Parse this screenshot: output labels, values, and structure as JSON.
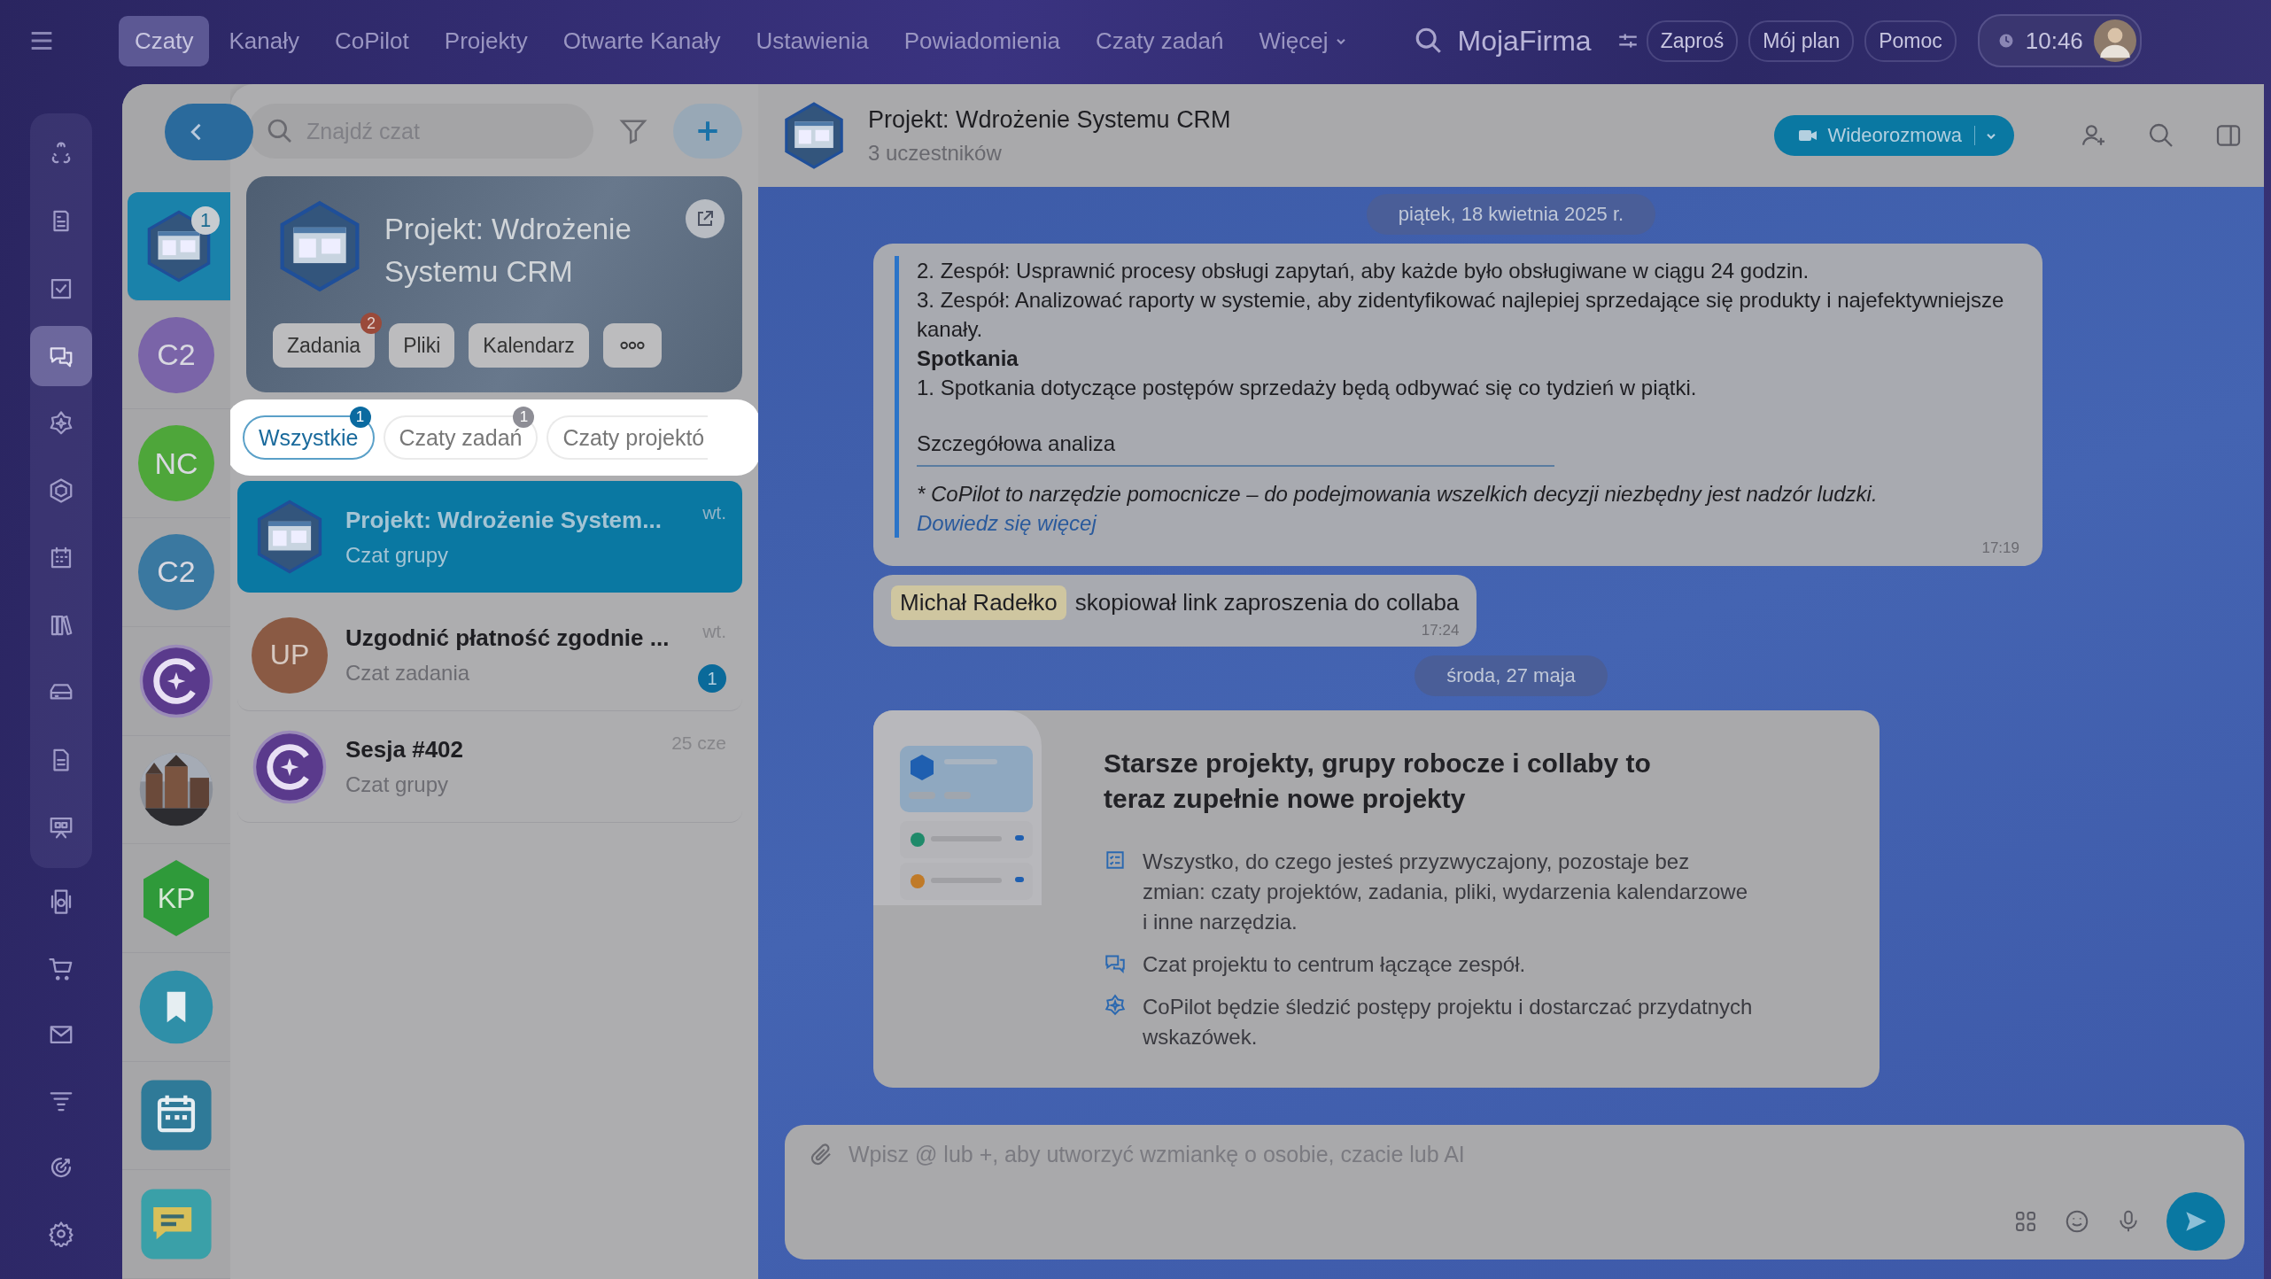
{
  "top_nav": {
    "items": [
      {
        "label": "Czaty",
        "selected": true,
        "kind": "link"
      },
      {
        "label": "Kanały",
        "selected": false,
        "kind": "link"
      },
      {
        "label": "CoPilot",
        "selected": false,
        "kind": "link"
      },
      {
        "label": "Projekty",
        "selected": false,
        "kind": "link"
      },
      {
        "label": "Otwarte Kanały",
        "selected": false,
        "kind": "link"
      },
      {
        "label": "Ustawienia",
        "selected": false,
        "kind": "link"
      },
      {
        "label": "Powiadomienia",
        "selected": false,
        "kind": "link"
      },
      {
        "label": "Czaty zadań",
        "selected": false,
        "kind": "link"
      },
      {
        "label": "Więcej",
        "selected": false,
        "kind": "dropdown"
      }
    ],
    "brand": "MojaFirma",
    "buttons": [
      "Zaproś",
      "Mój plan",
      "Pomoc"
    ],
    "time": "10:46"
  },
  "rail": {
    "group": [
      {
        "kind": "share",
        "selected": false
      },
      {
        "kind": "news",
        "selected": false
      },
      {
        "kind": "tasks",
        "selected": false
      },
      {
        "kind": "chat",
        "selected": true
      },
      {
        "kind": "sparkle",
        "selected": false
      },
      {
        "kind": "hexagon",
        "selected": false
      },
      {
        "kind": "calendar",
        "selected": false
      },
      {
        "kind": "books",
        "selected": false
      },
      {
        "kind": "drive",
        "selected": false
      },
      {
        "kind": "document",
        "selected": false
      },
      {
        "kind": "board",
        "selected": false
      }
    ],
    "items": [
      {
        "kind": "phone",
        "selected": false
      },
      {
        "kind": "cart",
        "selected": false
      },
      {
        "kind": "mail",
        "selected": false
      },
      {
        "kind": "funnel",
        "selected": false
      },
      {
        "kind": "target",
        "selected": false
      }
    ],
    "bottom": [
      {
        "kind": "settings",
        "selected": false
      }
    ]
  },
  "recent": [
    {
      "kind": "project",
      "selected": true,
      "badge": "1"
    },
    {
      "kind": "initials",
      "initials": "C2",
      "color": "#7a64a8",
      "selected": false
    },
    {
      "kind": "initials",
      "initials": "NC",
      "color": "#4ea63a",
      "selected": false
    },
    {
      "kind": "initials",
      "initials": "C2",
      "color": "#3a78a0",
      "selected": false
    },
    {
      "kind": "copilot",
      "selected": false
    },
    {
      "kind": "picture",
      "selected": false
    },
    {
      "kind": "hex",
      "initials": "KP",
      "color": "#2f9a3a",
      "selected": false
    },
    {
      "kind": "bookmark",
      "selected": false
    },
    {
      "kind": "calendar",
      "selected": false
    },
    {
      "kind": "chat",
      "selected": false
    }
  ],
  "chat_list": {
    "search": {
      "placeholder": "Znajdź czat"
    },
    "project_card": {
      "title": "Projekt: Wdrożenie Systemu CRM",
      "buttons": [
        {
          "label": "Zadania",
          "badge": "2"
        },
        {
          "label": "Pliki"
        },
        {
          "label": "Kalendarz"
        }
      ]
    },
    "tabs": [
      {
        "label": "Wszystkie",
        "selected": true,
        "badge": "1",
        "muted": false
      },
      {
        "label": "Czaty zadań",
        "selected": false,
        "badge": "1",
        "muted": true
      },
      {
        "label": "Czaty projektó",
        "selected": false
      }
    ],
    "chats": [
      {
        "kind": "project",
        "title": "Projekt: Wdrożenie System...",
        "subtitle": "Czat grupy",
        "time": "wt.",
        "selected": true
      },
      {
        "kind": "initials",
        "initials": "UP",
        "color": "#8a5a44",
        "title": "Uzgodnić płatność zgodnie ...",
        "subtitle": "Czat zadania",
        "time": "wt.",
        "unread": "1",
        "selected": false
      },
      {
        "kind": "copilot",
        "title": "Sesja #402",
        "subtitle": "Czat grupy",
        "time": "25 cze",
        "selected": false
      }
    ]
  },
  "chat": {
    "title": "Projekt: Wdrożenie Systemu CRM",
    "subtitle": "3 uczestników",
    "video_button": "Wideorozmowa",
    "messages": [
      {
        "kind": "copilot",
        "time": "17:19",
        "lines": [
          {
            "kind": "text",
            "text": "2. Zespół: Usprawnić procesy obsługi zapytań, aby każde było obsługiwane w ciągu 24 godzin."
          },
          {
            "kind": "text",
            "text": "3. Zespół: Analizować raporty w systemie, aby zidentyfikować najlepiej sprzedające się produkty i najefektywniejsze kanały."
          },
          {
            "kind": "heading",
            "text": "Spotkania"
          },
          {
            "kind": "text",
            "text": "1. Spotkania dotyczące postępów sprzedaży będą odbywać się co tydzień w piątki."
          },
          {
            "kind": "section",
            "text": "Szczegółowa analiza"
          },
          {
            "kind": "note",
            "text": "* CoPilot to narzędzie pomocnicze – do podejmowania wszelkich decyzji niezbędny jest nadzór ludzki."
          },
          {
            "kind": "link",
            "text": "Dowiedz się więcej"
          }
        ]
      },
      {
        "kind": "system",
        "name": "Michał Radełko",
        "text": "skopiował link zaproszenia do collaba",
        "time": "17:24"
      },
      {
        "kind": "date",
        "text": "środa, 27 maja"
      },
      {
        "kind": "card",
        "title": "Starsze projekty, grupy robocze i collaby to teraz zupełnie nowe projekty",
        "items": [
          {
            "kind": "checklist",
            "text": "Wszystko, do czego jesteś przyzwyczajony, pozostaje bez zmian: czaty projektów, zadania, pliki, wydarzenia kalendarzowe i inne narzędzia."
          },
          {
            "kind": "chat",
            "text": "Czat projektu to centrum łączące zespół."
          },
          {
            "kind": "sparkle",
            "text": "CoPilot będzie śledzić postępy projektu i dostarczać przydatnych wskazówek."
          }
        ]
      }
    ],
    "sticky_date": "piątek, 18 kwietnia 2025 r.",
    "composer": {
      "placeholder": "Wpisz @ lub +, aby utworzyć wzmiankę o osobie, czacie lub AI"
    }
  }
}
